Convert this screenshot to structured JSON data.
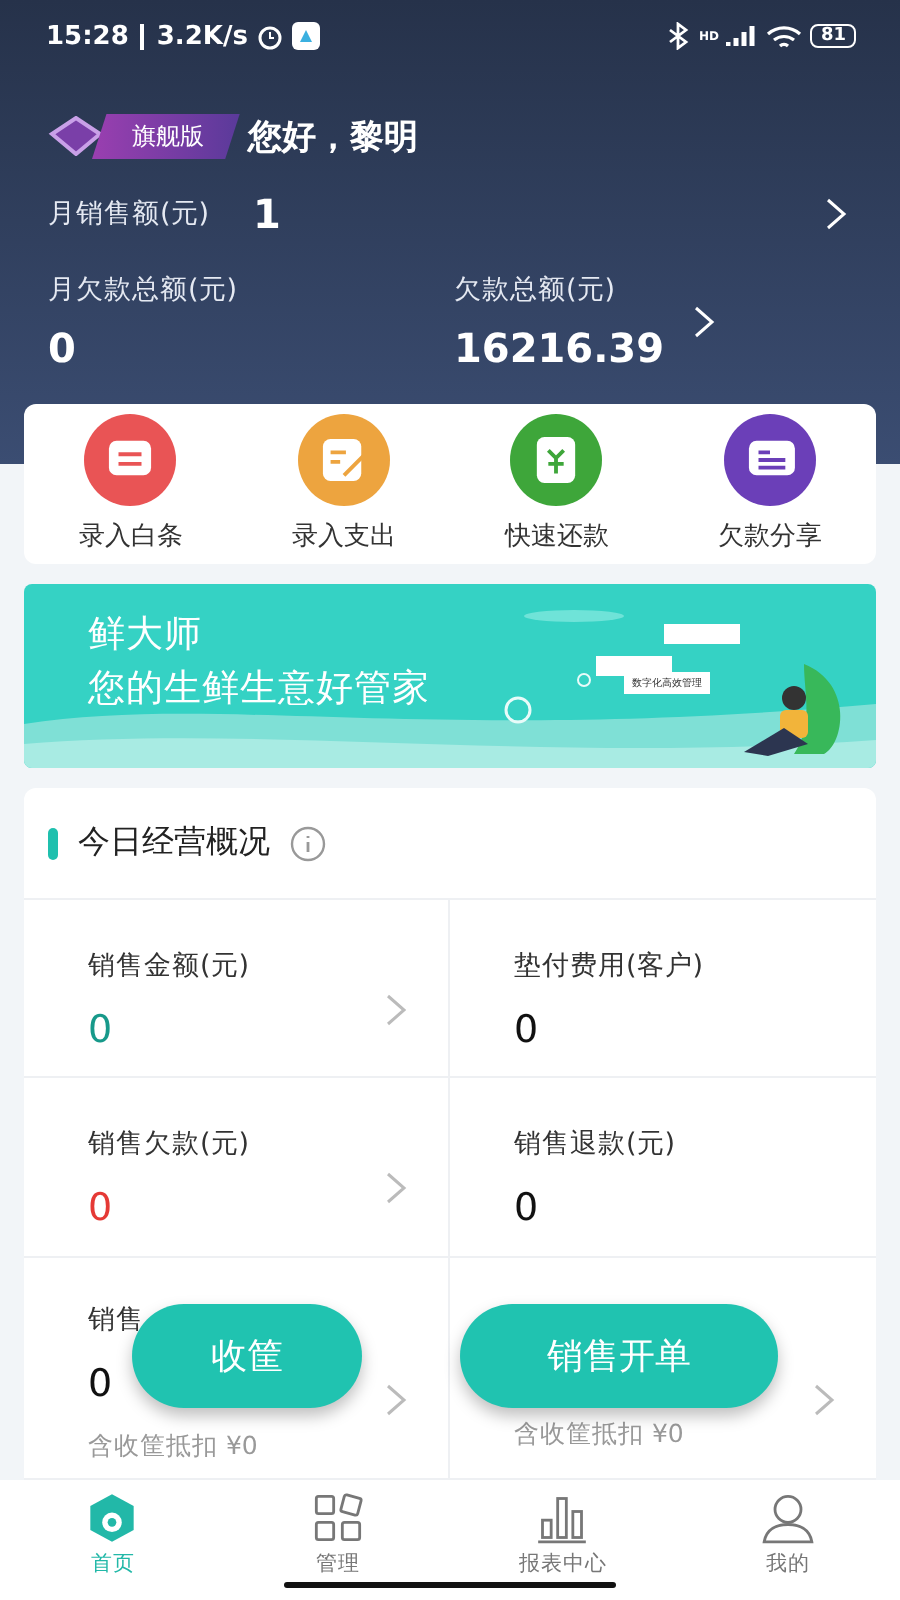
{
  "status_bar": {
    "time": "15:28",
    "speed": "3.2K/s",
    "network": "HD",
    "battery": "81"
  },
  "header": {
    "badge": "旗舰版",
    "greeting": "您好，黎明",
    "monthly_sales": {
      "label": "月销售额(元)",
      "value": "1"
    },
    "stats": [
      {
        "label": "月欠款总额(元)",
        "value": "0",
        "arrow": false
      },
      {
        "label": "欠款总额(元)",
        "value": "16216.39",
        "arrow": true
      }
    ]
  },
  "quick_actions": [
    {
      "label": "录入白条",
      "kind": "note",
      "color": "#e95455"
    },
    {
      "label": "录入支出",
      "kind": "edit",
      "color": "#eda43f"
    },
    {
      "label": "快速还款",
      "kind": "money",
      "color": "#3ea63a"
    },
    {
      "label": "欠款分享",
      "kind": "share",
      "color": "#6b3fb8"
    }
  ],
  "banner": {
    "title": "鲜大师",
    "subtitle": "您的生鲜生意好管家",
    "bubble": "数字化高效管理"
  },
  "overview": {
    "title": "今日经营概况",
    "cells": [
      {
        "label": "销售金额(元)",
        "value": "0",
        "color": "#17998a",
        "arrow": true
      },
      {
        "label": "垫付费用(客户)",
        "value": "0",
        "color": "#111111",
        "arrow": false
      },
      {
        "label": "销售欠款(元)",
        "value": "0",
        "color": "#e53935",
        "arrow": true
      },
      {
        "label": "销售退款(元)",
        "value": "0",
        "color": "#111111",
        "arrow": false
      },
      {
        "label": "销售",
        "value": "0",
        "color": "#111111",
        "arrow": true,
        "note": "含收筐抵扣 ¥0"
      },
      {
        "arrow": true,
        "note": "含收筐抵扣 ¥0"
      }
    ]
  },
  "floating_buttons": [
    "收筐",
    "销售开单"
  ],
  "tabs": [
    {
      "label": "首页",
      "kind": "home",
      "selected": true
    },
    {
      "label": "管理",
      "kind": "grid",
      "selected": false
    },
    {
      "label": "报表中心",
      "kind": "chart",
      "selected": false
    },
    {
      "label": "我的",
      "kind": "user",
      "selected": false
    }
  ]
}
